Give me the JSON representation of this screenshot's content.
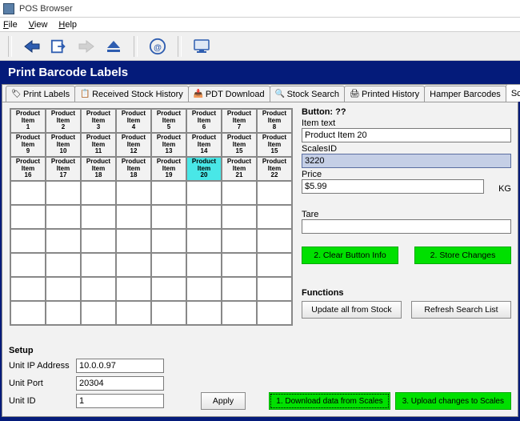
{
  "window": {
    "title": "POS Browser"
  },
  "menu": {
    "file": "File",
    "view": "View",
    "help": "Help"
  },
  "heading": "Print Barcode Labels",
  "tabs": [
    {
      "label": "Print Labels"
    },
    {
      "label": "Received Stock History"
    },
    {
      "label": "PDT Download"
    },
    {
      "label": "Stock Search"
    },
    {
      "label": "Printed History"
    },
    {
      "label": "Hamper Barcodes"
    },
    {
      "label": "Scales",
      "active": true
    }
  ],
  "grid": {
    "rows": [
      [
        "Product Item 1",
        "Product Item 2",
        "Product Item 3",
        "Product Item 4",
        "Product Item 5",
        "Product Item 6",
        "Product Item 7",
        "Product Item 8"
      ],
      [
        "Product Item 9",
        "Product Item 10",
        "Product Item 11",
        "Product Item 12",
        "Product Item 13",
        "Product Item 14",
        "Product Item 15",
        "Product Item 15"
      ],
      [
        "Product Item 16",
        "Product Item 17",
        "Product Item 18",
        "Product Item 18",
        "Product Item 19",
        "Product Item 20",
        "Product Item 21",
        "Product Item 22"
      ]
    ],
    "selected": {
      "row": 2,
      "col": 5
    }
  },
  "detail": {
    "header": "Button: ??",
    "item_text_label": "Item text",
    "item_text": "Product Item 20",
    "scalesid_label": "ScalesID",
    "scalesid": "3220",
    "price_label": "Price",
    "price": "$5.99",
    "kg": "KG",
    "tare_label": "Tare",
    "tare": "",
    "clear_btn": "2. Clear Button Info",
    "store_btn": "2. Store Changes"
  },
  "functions": {
    "header": "Functions",
    "update_btn": "Update all from Stock",
    "refresh_btn": "Refresh Search List"
  },
  "setup": {
    "header": "Setup",
    "ip_label": "Unit IP Address",
    "ip": "10.0.0.97",
    "port_label": "Unit Port",
    "port": "20304",
    "id_label": "Unit ID",
    "id": "1",
    "apply": "Apply"
  },
  "bottom": {
    "download": "1. Download data from Scales",
    "upload": "3. Upload changes to Scales"
  }
}
